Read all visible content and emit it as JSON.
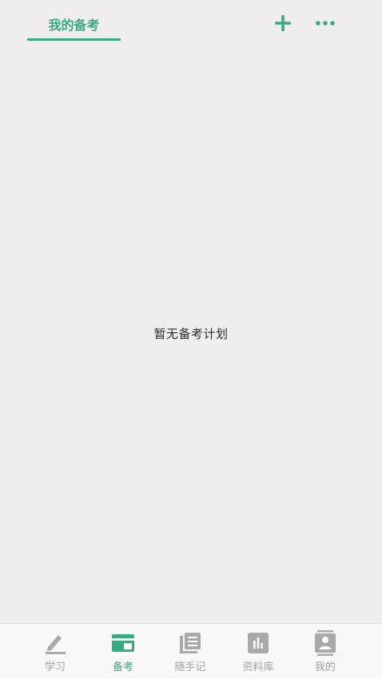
{
  "header": {
    "active_tab_label": "我的备考",
    "plus_icon": "plus-icon",
    "more_icon": "more-dots-icon"
  },
  "empty_state": {
    "message": "暂无备考计划"
  },
  "bottom_nav": {
    "items": [
      {
        "label": "学习",
        "icon": "pencil-icon",
        "active": false
      },
      {
        "label": "备考",
        "icon": "card-icon",
        "active": true
      },
      {
        "label": "随手记",
        "icon": "notes-icon",
        "active": false
      },
      {
        "label": "资料库",
        "icon": "bar-chart-icon",
        "active": false
      },
      {
        "label": "我的",
        "icon": "profile-icon",
        "active": false
      }
    ]
  },
  "colors": {
    "accent": "#3aaa7f",
    "background": "#efedee",
    "inactive": "#a3a3a3",
    "text": "#2c2c2c"
  }
}
